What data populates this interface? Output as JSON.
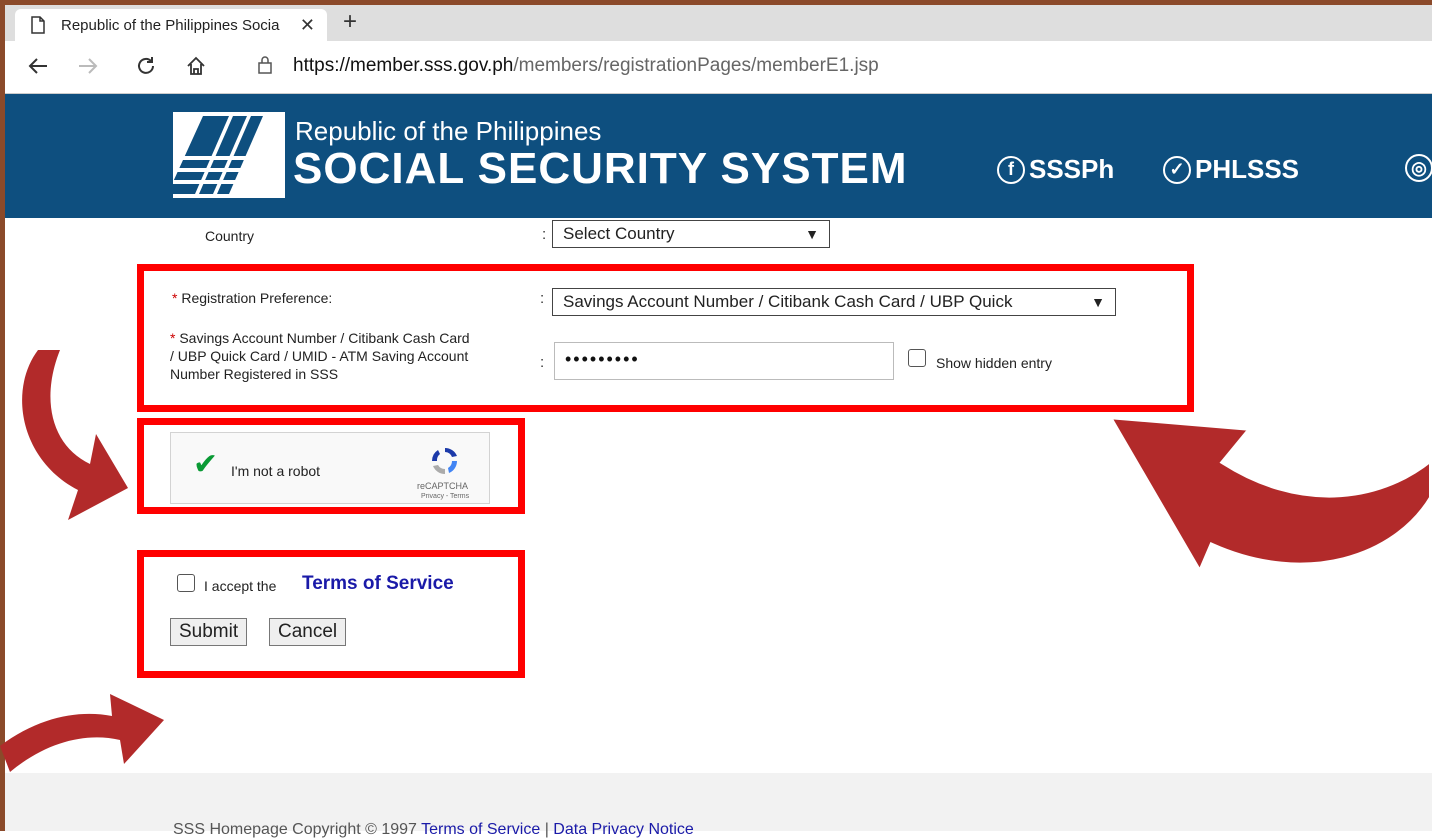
{
  "browser": {
    "tab_title": "Republic of the Philippines Socia",
    "close_glyph": "✕",
    "newtab_glyph": "+",
    "url_host": "https://member.sss.gov.ph",
    "url_path": "/members/registrationPages/memberE1.jsp",
    "icons": [
      "back-icon",
      "forward-icon",
      "reload-icon",
      "home-icon",
      "lock-icon"
    ]
  },
  "header": {
    "republic": "Republic of the Philippines",
    "system": "SOCIAL SECURITY SYSTEM",
    "facebook": "SSSPh",
    "twitter": "PHLSSS",
    "bg_color": "#0e4f7f"
  },
  "form": {
    "country_label": "Country",
    "country_value": "Select Country",
    "colon": ":",
    "req_mark": "*",
    "preference_label": "Registration Preference:",
    "preference_value": "Savings Account Number / Citibank Cash Card / UBP Quick",
    "account_label_1": "Savings Account Number / Citibank Cash Card",
    "account_label_2": "/ UBP Quick Card / UMID - ATM Saving Account",
    "account_label_3": "Number Registered in SSS",
    "account_value": "•••••••••",
    "show_hidden": "Show hidden entry"
  },
  "captcha": {
    "label": "I'm not a robot",
    "brand": "reCAPTCHA",
    "links": "Privacy - Terms"
  },
  "terms": {
    "accept": "I accept the",
    "link": "Terms of Service"
  },
  "buttons": {
    "submit": "Submit",
    "cancel": "Cancel"
  },
  "footer": {
    "copyright": "SSS Homepage Copyright © 1997",
    "terms": "Terms of Service",
    "sep": "|",
    "privacy": "Data Privacy Notice"
  },
  "annotation_colors": {
    "box": "#ff0000",
    "arrow": "#b22a2a"
  }
}
